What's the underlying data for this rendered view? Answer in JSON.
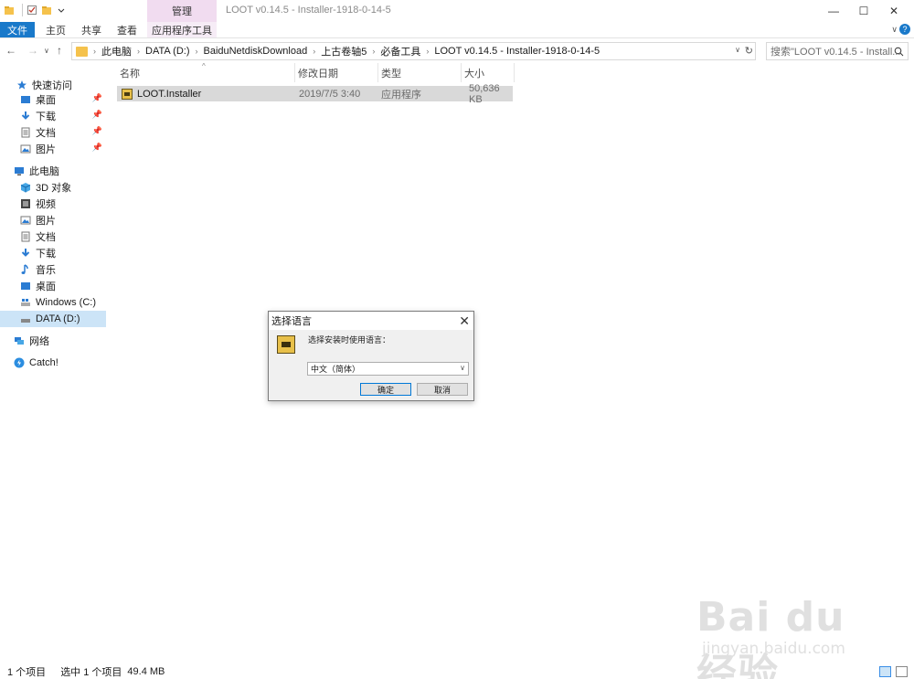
{
  "window": {
    "title": "LOOT v0.14.5 - Installer-1918-0-14-5",
    "context_tab_header": "管理",
    "minimize": "—",
    "maximize": "☐",
    "close": "✕"
  },
  "ribbon": {
    "tabs": [
      "文件",
      "主页",
      "共享",
      "查看",
      "应用程序工具"
    ],
    "expand": "∨",
    "help": "?"
  },
  "address": {
    "crumbs": [
      "此电脑",
      "DATA (D:)",
      "BaiduNetdiskDownload",
      "上古卷轴5",
      "必备工具",
      "LOOT v0.14.5 - Installer-1918-0-14-5"
    ],
    "search_placeholder": "搜索\"LOOT v0.14.5 - Install..."
  },
  "nav": {
    "quick_access": "快速访问",
    "quick_items": [
      "桌面",
      "下载",
      "文档",
      "图片"
    ],
    "this_pc": "此电脑",
    "pc_items": [
      "3D 对象",
      "视频",
      "图片",
      "文档",
      "下载",
      "音乐",
      "桌面",
      "Windows (C:)",
      "DATA (D:)"
    ],
    "network": "网络",
    "catch": "Catch!"
  },
  "columns": [
    "名称",
    "修改日期",
    "类型",
    "大小"
  ],
  "files": [
    {
      "name": "LOOT.Installer",
      "modified": "2019/7/5 3:40",
      "type": "应用程序",
      "size": "50,636 KB"
    }
  ],
  "dialog": {
    "title": "选择语言",
    "prompt": "选择安装时使用语言：",
    "selected_language": "中文（简体）",
    "ok_label": "确定",
    "cancel_label": "取消"
  },
  "status": {
    "item_count": "1 个项目",
    "selected": "选中 1 个项目",
    "size": "49.4 MB"
  },
  "watermark": {
    "main": "Bai du 经验",
    "sub": "jingyan.baidu.com"
  },
  "colors": {
    "file_tab": "#1979ca",
    "context_tab": "#f1dcf0",
    "selection": "#cce4f7",
    "row_highlight": "#d9d9d9"
  }
}
